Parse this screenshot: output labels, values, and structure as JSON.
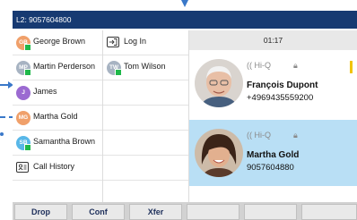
{
  "topbar": {
    "line_label": "L2: 9057604800"
  },
  "contacts_col1": [
    {
      "initials": "GB",
      "name": "George Brown",
      "avatar_color": "#f0a06a",
      "online": true
    },
    {
      "initials": "MP",
      "name": "Martin Perderson",
      "avatar_color": "#a7b3c2",
      "online": true
    },
    {
      "initials": "J",
      "name": "James",
      "avatar_color": "#9b6ad1",
      "online": false
    },
    {
      "initials": "MG",
      "name": "Martha Gold",
      "avatar_color": "#f0a06a",
      "online": false
    },
    {
      "initials": "SB",
      "name": "Samantha Brown",
      "avatar_color": "#58b7e8",
      "online": true
    }
  ],
  "call_history": {
    "label": "Call History",
    "icon": "call-history-icon"
  },
  "contacts_col2": [
    {
      "type": "key",
      "label": "Log In",
      "icon": "login-icon"
    },
    {
      "type": "contact",
      "initials": "TW",
      "name": "Tom Wilson",
      "avatar_color": "#a7b3c2",
      "online": true
    }
  ],
  "call_panel": {
    "timer": "01:17",
    "calls": [
      {
        "hdq": "((  Hi-Q",
        "name": "François Dupont",
        "number": "+4969435559200",
        "active": false
      },
      {
        "hdq": "((  Hi-Q",
        "name": "Martha Gold",
        "number": "9057604880",
        "active": true
      }
    ]
  },
  "softkeys": [
    "Drop",
    "Conf",
    "Xfer",
    "",
    "",
    ""
  ],
  "colors": {
    "topbar": "#173a72",
    "active_call": "#b9dff5",
    "presence_online": "#1fb84a",
    "annotation": "#3a78c9"
  }
}
